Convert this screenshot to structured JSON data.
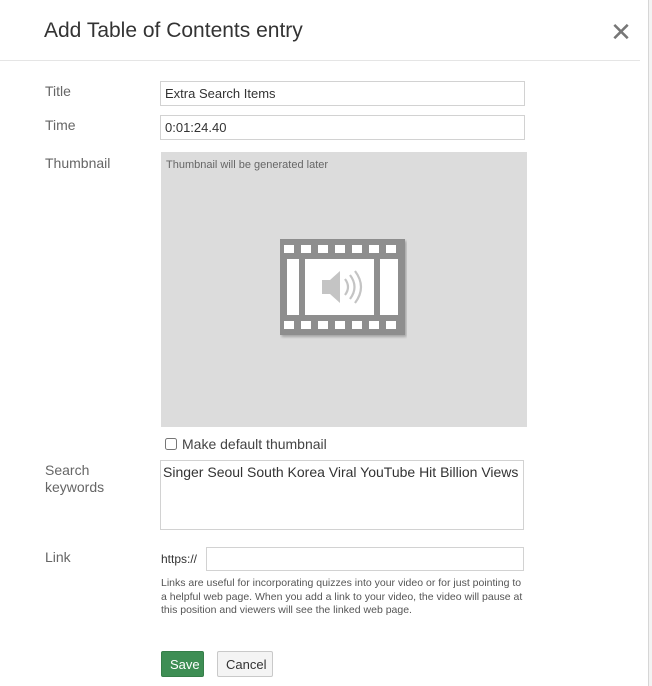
{
  "dialog": {
    "title": "Add Table of Contents entry",
    "close_glyph": "✕"
  },
  "form": {
    "title_label": "Title",
    "title_value": "Extra Search Items",
    "time_label": "Time",
    "time_value": "0:01:24.40",
    "thumbnail_label": "Thumbnail",
    "thumbnail_note": "Thumbnail will be generated later",
    "thumbnail_icon": "audio-filmstrip-icon",
    "make_default_label": "Make default thumbnail",
    "make_default_checked": false,
    "search_label_line1": "Search",
    "search_label_line2": "keywords",
    "search_value": "Singer Seoul South Korea Viral YouTube Hit Billion Views",
    "link_label": "Link",
    "link_prefix": "https://",
    "link_value": "",
    "link_help": "Links are useful for incorporating quizzes into your video or for just pointing to a helpful web page. When you add a link to your video, the video will pause at this position and viewers will see the linked web page."
  },
  "buttons": {
    "save_label": "Save",
    "cancel_label": "Cancel"
  },
  "colors": {
    "save_bg": "#3e8e54",
    "thumbnail_bg": "#dcdcdc",
    "icon_gray": "#8e8e8e"
  }
}
